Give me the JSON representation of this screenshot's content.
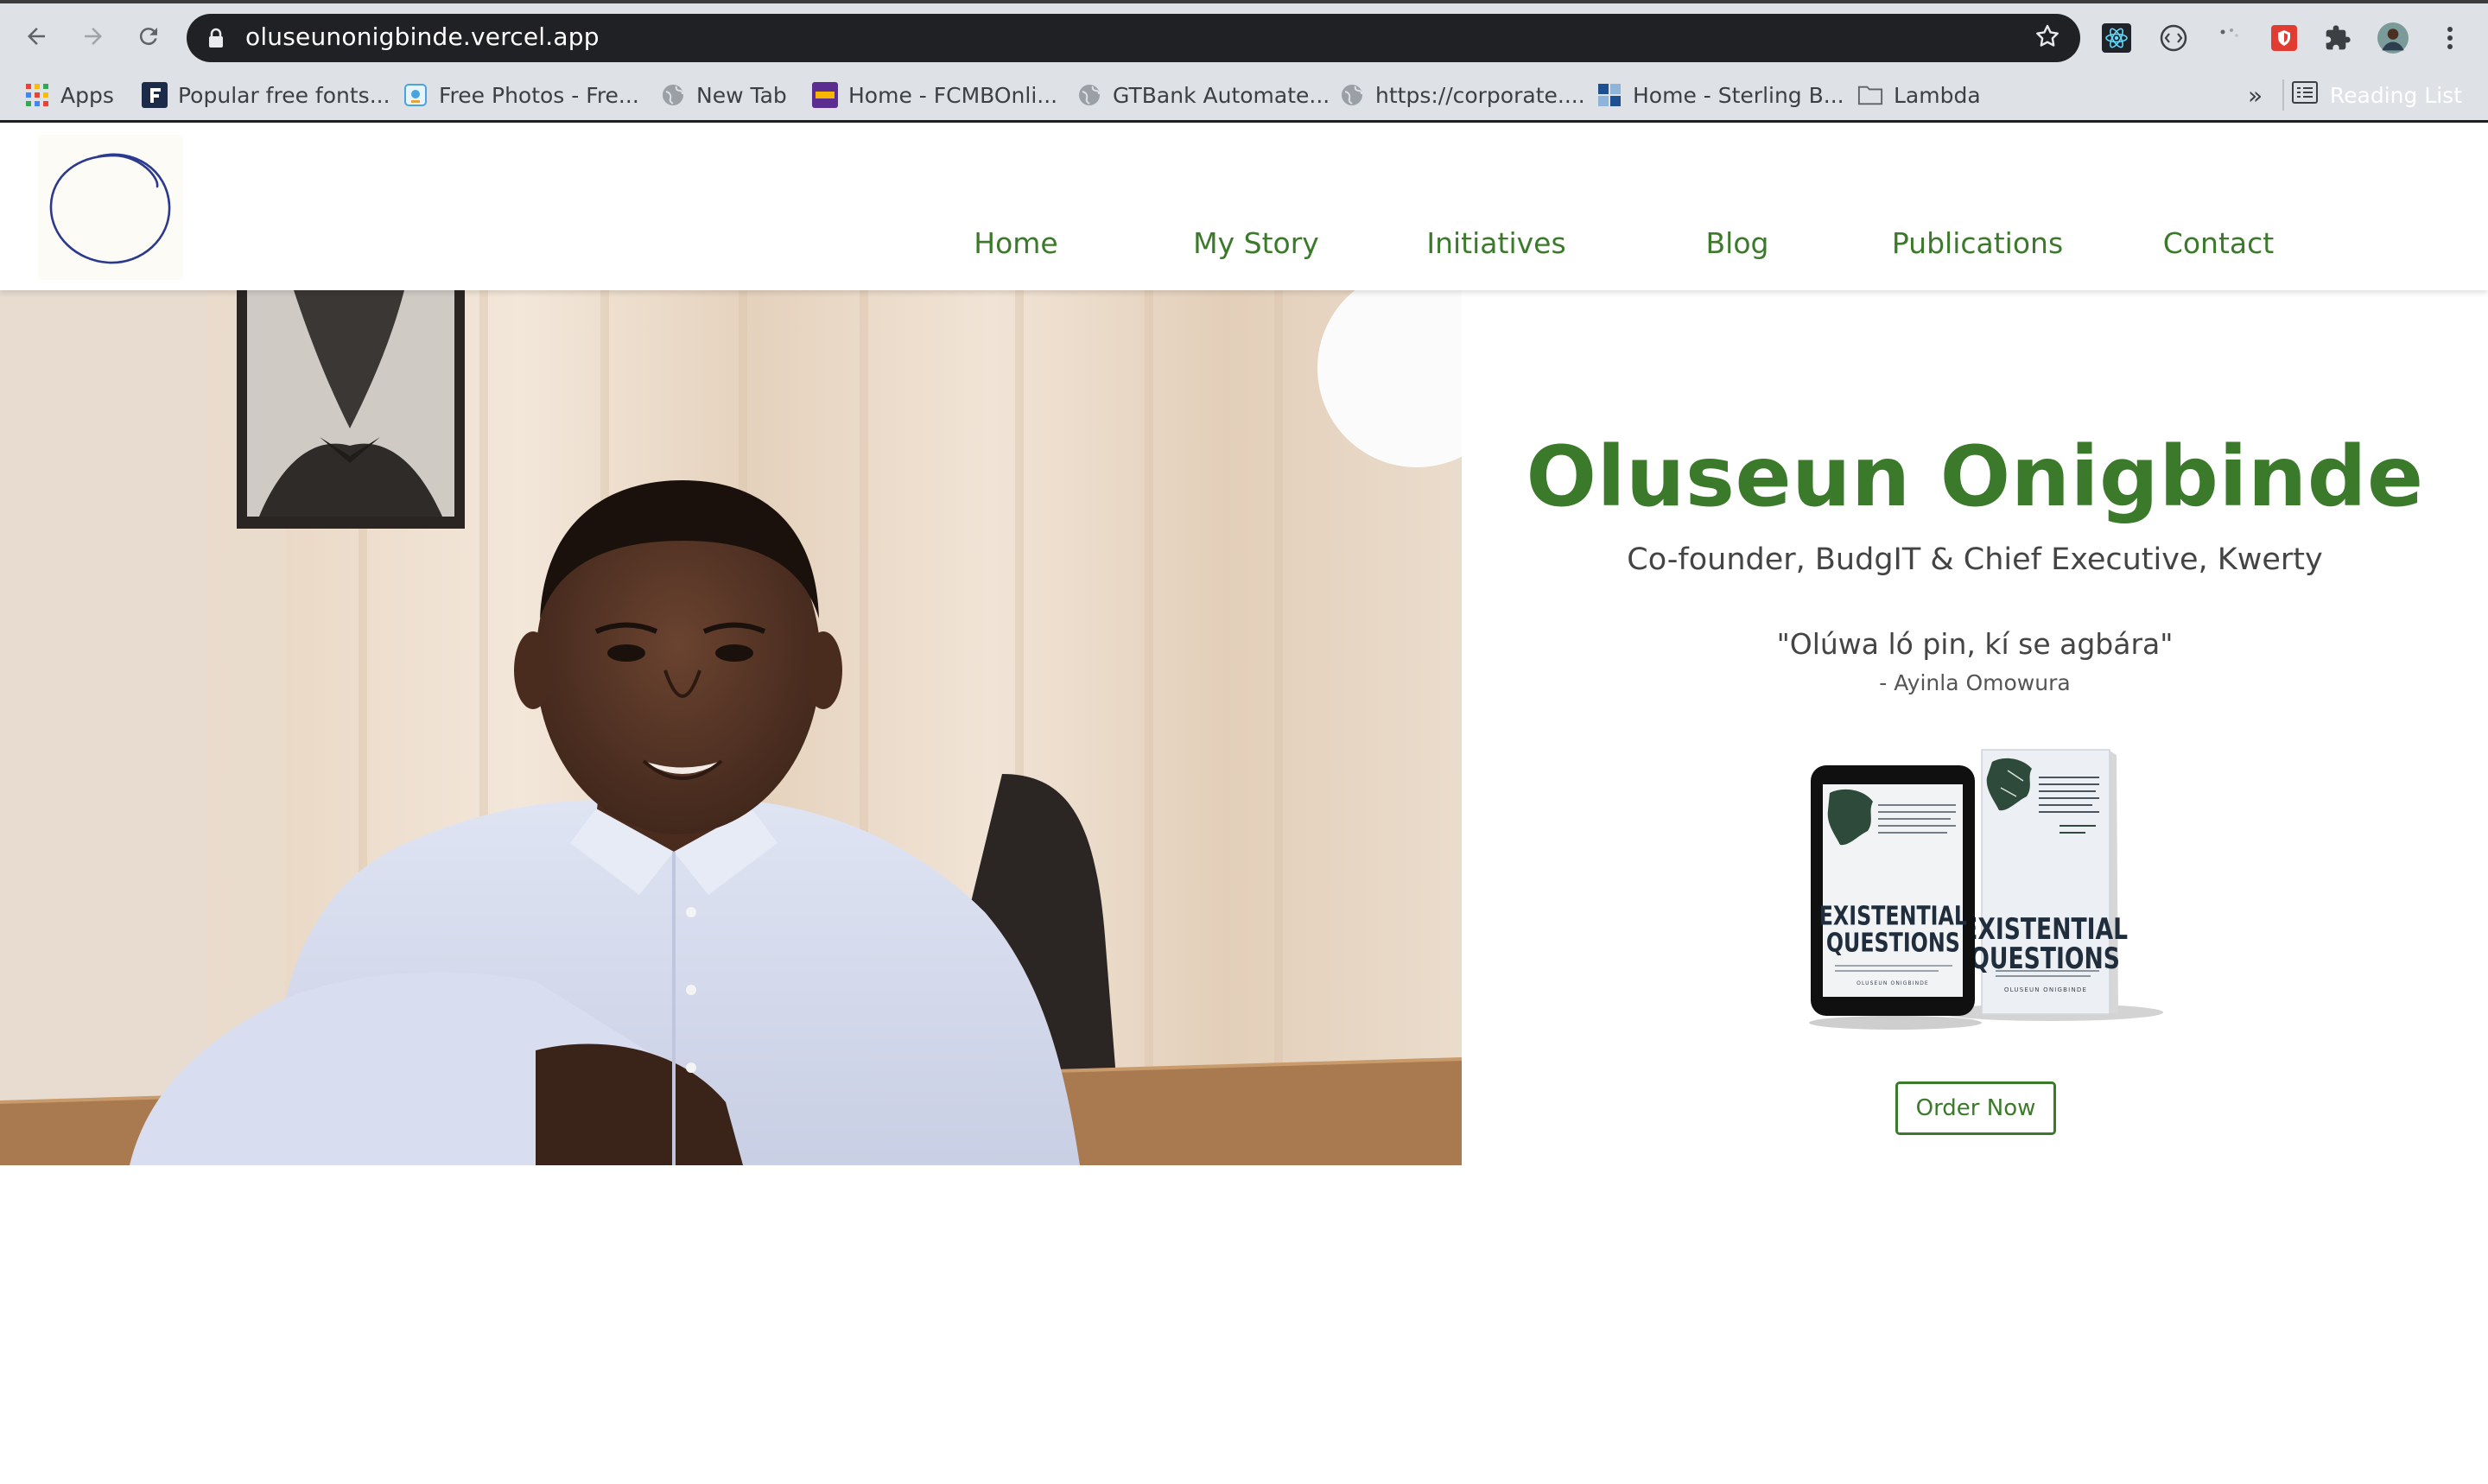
{
  "browser": {
    "url": "oluseunonigbinde.vercel.app",
    "back_icon": "arrow-left-icon",
    "forward_icon": "arrow-right-icon",
    "reload_icon": "reload-icon",
    "bookmarks": [
      {
        "label": "Apps",
        "icon": "apps-grid-icon"
      },
      {
        "label": "Popular free fonts...",
        "icon": "fonts-favicon"
      },
      {
        "label": "Free Photos - Fre...",
        "icon": "photos-favicon"
      },
      {
        "label": "New Tab",
        "icon": "globe-icon"
      },
      {
        "label": "Home - FCMBOnli...",
        "icon": "fcmb-favicon"
      },
      {
        "label": "GTBank Automate...",
        "icon": "globe-icon"
      },
      {
        "label": "https://corporate....",
        "icon": "globe-icon"
      },
      {
        "label": "Home - Sterling B...",
        "icon": "sterling-favicon"
      },
      {
        "label": "Lambda",
        "icon": "folder-icon"
      }
    ],
    "overflow_label": "»",
    "reading_list_label": "Reading List"
  },
  "site": {
    "logo_icon": "circle-logo",
    "nav": [
      "Home",
      "My Story",
      "Initiatives",
      "Blog",
      "Publications",
      "Contact"
    ],
    "accent_color": "#3b7a2a"
  },
  "hero": {
    "name": "Oluseun Onigbinde",
    "role": "Co-founder, BudgIT & Chief Executive, Kwerty",
    "quote": "\"Olúwa ló pin, kí se agbára\"",
    "attribution": "- Ayinla Omowura",
    "book": {
      "title_line1": "EXISTENTIAL",
      "title_line2": "QUESTIONS",
      "author": "OLUSEUN ONIGBINDE"
    },
    "order_button": "Order Now"
  }
}
